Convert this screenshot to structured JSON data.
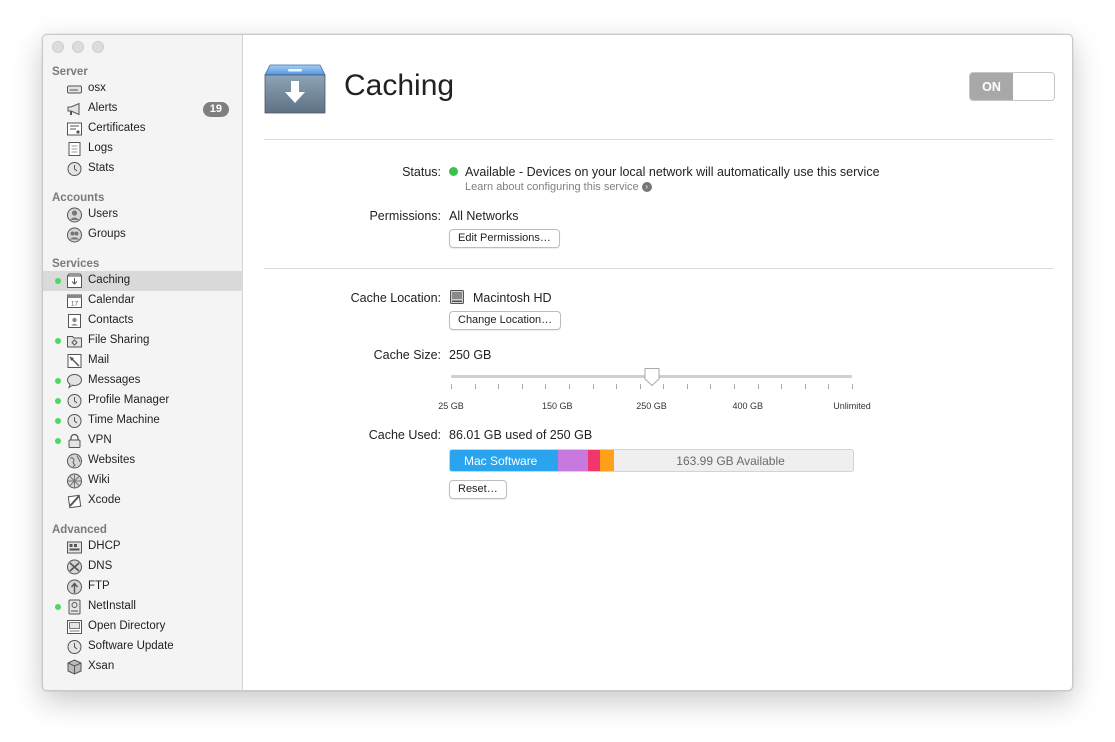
{
  "sidebar": {
    "sections": [
      {
        "title": "Server",
        "items": [
          {
            "label": "osx",
            "icon": "server-icon"
          },
          {
            "label": "Alerts",
            "icon": "megaphone-icon",
            "badge": "19"
          },
          {
            "label": "Certificates",
            "icon": "certificate-icon"
          },
          {
            "label": "Logs",
            "icon": "log-icon"
          },
          {
            "label": "Stats",
            "icon": "stats-icon"
          }
        ]
      },
      {
        "title": "Accounts",
        "items": [
          {
            "label": "Users",
            "icon": "user-icon"
          },
          {
            "label": "Groups",
            "icon": "group-icon"
          }
        ]
      },
      {
        "title": "Services",
        "items": [
          {
            "label": "Caching",
            "icon": "caching-icon",
            "active": true,
            "selected": true
          },
          {
            "label": "Calendar",
            "icon": "calendar-icon"
          },
          {
            "label": "Contacts",
            "icon": "contacts-icon"
          },
          {
            "label": "File Sharing",
            "icon": "folder-icon",
            "active": true
          },
          {
            "label": "Mail",
            "icon": "mail-icon"
          },
          {
            "label": "Messages",
            "icon": "messages-icon",
            "active": true
          },
          {
            "label": "Profile Manager",
            "icon": "profile-manager-icon",
            "active": true
          },
          {
            "label": "Time Machine",
            "icon": "time-machine-icon",
            "active": true
          },
          {
            "label": "VPN",
            "icon": "lock-icon",
            "active": true
          },
          {
            "label": "Websites",
            "icon": "globe-icon"
          },
          {
            "label": "Wiki",
            "icon": "wiki-icon"
          },
          {
            "label": "Xcode",
            "icon": "xcode-icon"
          }
        ]
      },
      {
        "title": "Advanced",
        "items": [
          {
            "label": "DHCP",
            "icon": "dhcp-icon"
          },
          {
            "label": "DNS",
            "icon": "dns-icon"
          },
          {
            "label": "FTP",
            "icon": "ftp-icon"
          },
          {
            "label": "NetInstall",
            "icon": "netinstall-icon",
            "active": true
          },
          {
            "label": "Open Directory",
            "icon": "directory-icon"
          },
          {
            "label": "Software Update",
            "icon": "software-update-icon"
          },
          {
            "label": "Xsan",
            "icon": "xsan-icon"
          }
        ]
      }
    ]
  },
  "main": {
    "title": "Caching",
    "toggle_label": "ON",
    "status": {
      "label": "Status:",
      "value": "Available - Devices on your local network will automatically use this service",
      "link": "Learn about configuring this service"
    },
    "permissions": {
      "label": "Permissions:",
      "value": "All Networks",
      "button": "Edit Permissions…"
    },
    "cache_location": {
      "label": "Cache Location:",
      "value": "Macintosh HD",
      "button": "Change Location…"
    },
    "cache_size": {
      "label": "Cache Size:",
      "value": "250 GB",
      "slider_labels": [
        "25 GB",
        "150 GB",
        "250 GB",
        "400 GB",
        "Unlimited"
      ],
      "slider_position": 0.5
    },
    "cache_used": {
      "label": "Cache Used:",
      "value": "86.01 GB used of 250 GB",
      "segments": [
        {
          "label": "Mac Software",
          "fraction": 0.268,
          "color": "#2aa4ee"
        },
        {
          "label": "",
          "fraction": 0.075,
          "color": "#c879e0"
        },
        {
          "label": "",
          "fraction": 0.03,
          "color": "#f2356a"
        },
        {
          "label": "",
          "fraction": 0.033,
          "color": "#ff9f1a"
        }
      ],
      "available_label": "163.99 GB Available",
      "button": "Reset…"
    }
  }
}
